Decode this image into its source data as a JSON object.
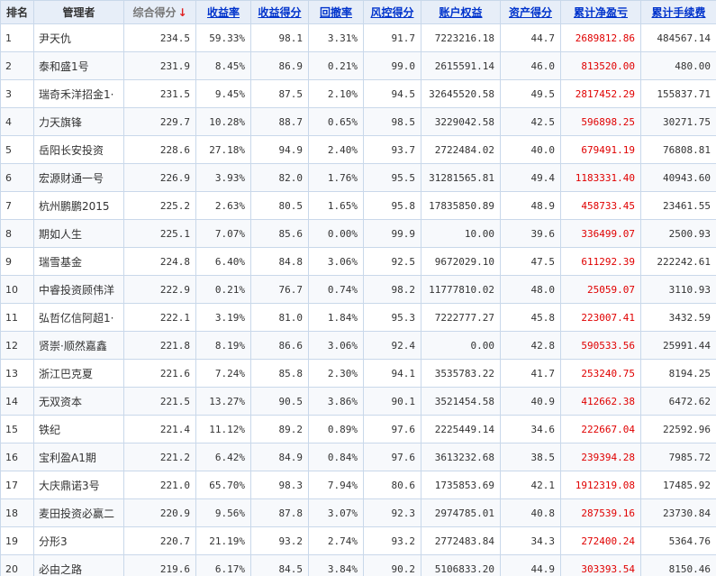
{
  "headers": {
    "rank": "排名",
    "manager": "管理者",
    "composite": "综合得分",
    "composite_arrow": "↓",
    "return_rate": "收益率",
    "return_score": "收益得分",
    "drawdown": "回撤率",
    "risk_score": "风控得分",
    "equity": "账户权益",
    "asset_score": "资产得分",
    "net_pnl": "累计净盈亏",
    "fees": "累计手续费"
  },
  "colors": {
    "header_bg": "#e7eef8",
    "link": "#0033cc",
    "pnl": "#e00000",
    "border": "#c9d8ea"
  },
  "rows": [
    {
      "rank": "1",
      "name": "尹天仇",
      "composite": "234.5",
      "return_rate": "59.33%",
      "return_score": "98.1",
      "drawdown": "3.31%",
      "risk_score": "91.7",
      "equity": "7223216.18",
      "asset_score": "44.7",
      "net_pnl": "2689812.86",
      "fees": "484567.14"
    },
    {
      "rank": "2",
      "name": "泰和盛1号",
      "composite": "231.9",
      "return_rate": "8.45%",
      "return_score": "86.9",
      "drawdown": "0.21%",
      "risk_score": "99.0",
      "equity": "2615591.14",
      "asset_score": "46.0",
      "net_pnl": "813520.00",
      "fees": "480.00"
    },
    {
      "rank": "3",
      "name": "瑞奇禾洋招金1·",
      "composite": "231.5",
      "return_rate": "9.45%",
      "return_score": "87.5",
      "drawdown": "2.10%",
      "risk_score": "94.5",
      "equity": "32645520.58",
      "asset_score": "49.5",
      "net_pnl": "2817452.29",
      "fees": "155837.71"
    },
    {
      "rank": "4",
      "name": "力天旗锋",
      "composite": "229.7",
      "return_rate": "10.28%",
      "return_score": "88.7",
      "drawdown": "0.65%",
      "risk_score": "98.5",
      "equity": "3229042.58",
      "asset_score": "42.5",
      "net_pnl": "596898.25",
      "fees": "30271.75"
    },
    {
      "rank": "5",
      "name": "岳阳长安投资",
      "composite": "228.6",
      "return_rate": "27.18%",
      "return_score": "94.9",
      "drawdown": "2.40%",
      "risk_score": "93.7",
      "equity": "2722484.02",
      "asset_score": "40.0",
      "net_pnl": "679491.19",
      "fees": "76808.81"
    },
    {
      "rank": "6",
      "name": "宏源财通一号",
      "composite": "226.9",
      "return_rate": "3.93%",
      "return_score": "82.0",
      "drawdown": "1.76%",
      "risk_score": "95.5",
      "equity": "31281565.81",
      "asset_score": "49.4",
      "net_pnl": "1183331.40",
      "fees": "40943.60"
    },
    {
      "rank": "7",
      "name": "杭州鹏鹏2015",
      "composite": "225.2",
      "return_rate": "2.63%",
      "return_score": "80.5",
      "drawdown": "1.65%",
      "risk_score": "95.8",
      "equity": "17835850.89",
      "asset_score": "48.9",
      "net_pnl": "458733.45",
      "fees": "23461.55"
    },
    {
      "rank": "8",
      "name": "期如人生",
      "composite": "225.1",
      "return_rate": "7.07%",
      "return_score": "85.6",
      "drawdown": "0.00%",
      "risk_score": "99.9",
      "equity": "10.00",
      "asset_score": "39.6",
      "net_pnl": "336499.07",
      "fees": "2500.93"
    },
    {
      "rank": "9",
      "name": "瑞雪基金",
      "composite": "224.8",
      "return_rate": "6.40%",
      "return_score": "84.8",
      "drawdown": "3.06%",
      "risk_score": "92.5",
      "equity": "9672029.10",
      "asset_score": "47.5",
      "net_pnl": "611292.39",
      "fees": "222242.61"
    },
    {
      "rank": "10",
      "name": "中睿投资顾伟洋",
      "composite": "222.9",
      "return_rate": "0.21%",
      "return_score": "76.7",
      "drawdown": "0.74%",
      "risk_score": "98.2",
      "equity": "11777810.02",
      "asset_score": "48.0",
      "net_pnl": "25059.07",
      "fees": "3110.93"
    },
    {
      "rank": "11",
      "name": "弘哲亿信阿超1·",
      "composite": "222.1",
      "return_rate": "3.19%",
      "return_score": "81.0",
      "drawdown": "1.84%",
      "risk_score": "95.3",
      "equity": "7222777.27",
      "asset_score": "45.8",
      "net_pnl": "223007.41",
      "fees": "3432.59"
    },
    {
      "rank": "12",
      "name": "贤崇·顺然嘉鑫",
      "composite": "221.8",
      "return_rate": "8.19%",
      "return_score": "86.6",
      "drawdown": "3.06%",
      "risk_score": "92.4",
      "equity": "0.00",
      "asset_score": "42.8",
      "net_pnl": "590533.56",
      "fees": "25991.44"
    },
    {
      "rank": "13",
      "name": "浙江巴克夏",
      "composite": "221.6",
      "return_rate": "7.24%",
      "return_score": "85.8",
      "drawdown": "2.30%",
      "risk_score": "94.1",
      "equity": "3535783.22",
      "asset_score": "41.7",
      "net_pnl": "253240.75",
      "fees": "8194.25"
    },
    {
      "rank": "14",
      "name": "无双资本",
      "composite": "221.5",
      "return_rate": "13.27%",
      "return_score": "90.5",
      "drawdown": "3.86%",
      "risk_score": "90.1",
      "equity": "3521454.58",
      "asset_score": "40.9",
      "net_pnl": "412662.38",
      "fees": "6472.62"
    },
    {
      "rank": "15",
      "name": "铁纪",
      "composite": "221.4",
      "return_rate": "11.12%",
      "return_score": "89.2",
      "drawdown": "0.89%",
      "risk_score": "97.6",
      "equity": "2225449.14",
      "asset_score": "34.6",
      "net_pnl": "222667.04",
      "fees": "22592.96"
    },
    {
      "rank": "16",
      "name": "宝利盈A1期",
      "composite": "221.2",
      "return_rate": "6.42%",
      "return_score": "84.9",
      "drawdown": "0.84%",
      "risk_score": "97.6",
      "equity": "3613232.68",
      "asset_score": "38.5",
      "net_pnl": "239394.28",
      "fees": "7985.72"
    },
    {
      "rank": "17",
      "name": "大庆鼎诺3号",
      "composite": "221.0",
      "return_rate": "65.70%",
      "return_score": "98.3",
      "drawdown": "7.94%",
      "risk_score": "80.6",
      "equity": "1735853.69",
      "asset_score": "42.1",
      "net_pnl": "1912319.08",
      "fees": "17485.92"
    },
    {
      "rank": "18",
      "name": "麦田投资必赢二",
      "composite": "220.9",
      "return_rate": "9.56%",
      "return_score": "87.8",
      "drawdown": "3.07%",
      "risk_score": "92.3",
      "equity": "2974785.01",
      "asset_score": "40.8",
      "net_pnl": "287539.16",
      "fees": "23730.84"
    },
    {
      "rank": "19",
      "name": "分形3",
      "composite": "220.7",
      "return_rate": "21.19%",
      "return_score": "93.2",
      "drawdown": "2.74%",
      "risk_score": "93.2",
      "equity": "2772483.84",
      "asset_score": "34.3",
      "net_pnl": "272400.24",
      "fees": "5364.76"
    },
    {
      "rank": "20",
      "name": "必由之路",
      "composite": "219.6",
      "return_rate": "6.17%",
      "return_score": "84.5",
      "drawdown": "3.84%",
      "risk_score": "90.2",
      "equity": "5106833.20",
      "asset_score": "44.9",
      "net_pnl": "303393.54",
      "fees": "8150.46"
    }
  ]
}
